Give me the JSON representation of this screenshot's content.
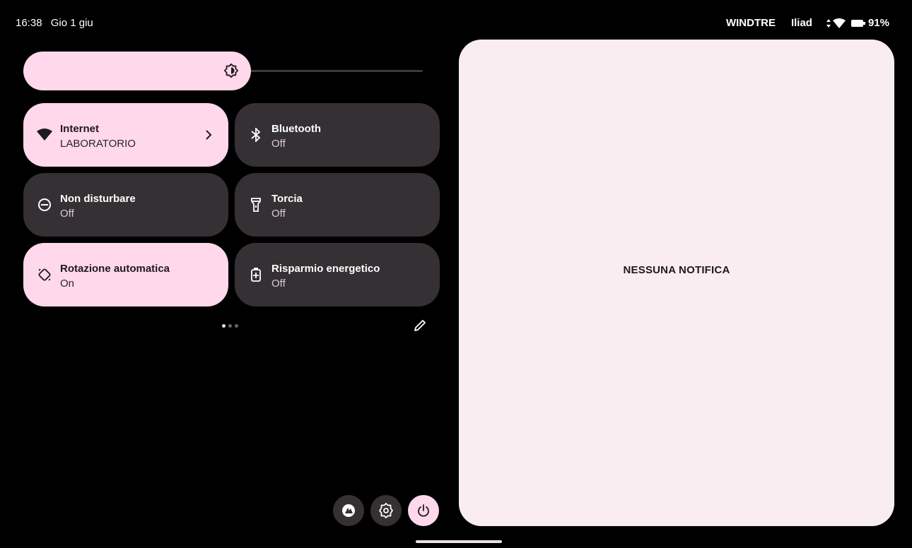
{
  "status_bar": {
    "time": "16:38",
    "date": "Gio 1 giu",
    "carriers": [
      "WINDTRE",
      "Iliad"
    ],
    "battery": "91%",
    "icons": [
      "data-arrows-icon",
      "wifi-icon",
      "battery-icon"
    ]
  },
  "brightness": {
    "icon": "brightness-icon",
    "level_percent": 55
  },
  "tiles": [
    {
      "title": "Internet",
      "subtitle": "LABORATORIO",
      "state": "on",
      "icon": "wifi-icon",
      "has_chevron": true
    },
    {
      "title": "Bluetooth",
      "subtitle": "Off",
      "state": "off",
      "icon": "bluetooth-icon"
    },
    {
      "title": "Non disturbare",
      "subtitle": "Off",
      "state": "off",
      "icon": "do-not-disturb-icon"
    },
    {
      "title": "Torcia",
      "subtitle": "Off",
      "state": "off",
      "icon": "flashlight-icon"
    },
    {
      "title": "Rotazione automatica",
      "subtitle": "On",
      "state": "on",
      "icon": "auto-rotate-icon"
    },
    {
      "title": "Risparmio energetico",
      "subtitle": "Off",
      "state": "off",
      "icon": "battery-saver-icon"
    }
  ],
  "pager": {
    "pages": 3,
    "current": 1
  },
  "actions": [
    "user-switch-icon",
    "settings-icon",
    "power-icon"
  ],
  "notifications": {
    "empty_text": "NESSUNA NOTIFICA"
  },
  "colors": {
    "tile_on": "#ffd8ec",
    "tile_off": "#353033",
    "panel": "#f9edf1",
    "background": "#000000"
  }
}
